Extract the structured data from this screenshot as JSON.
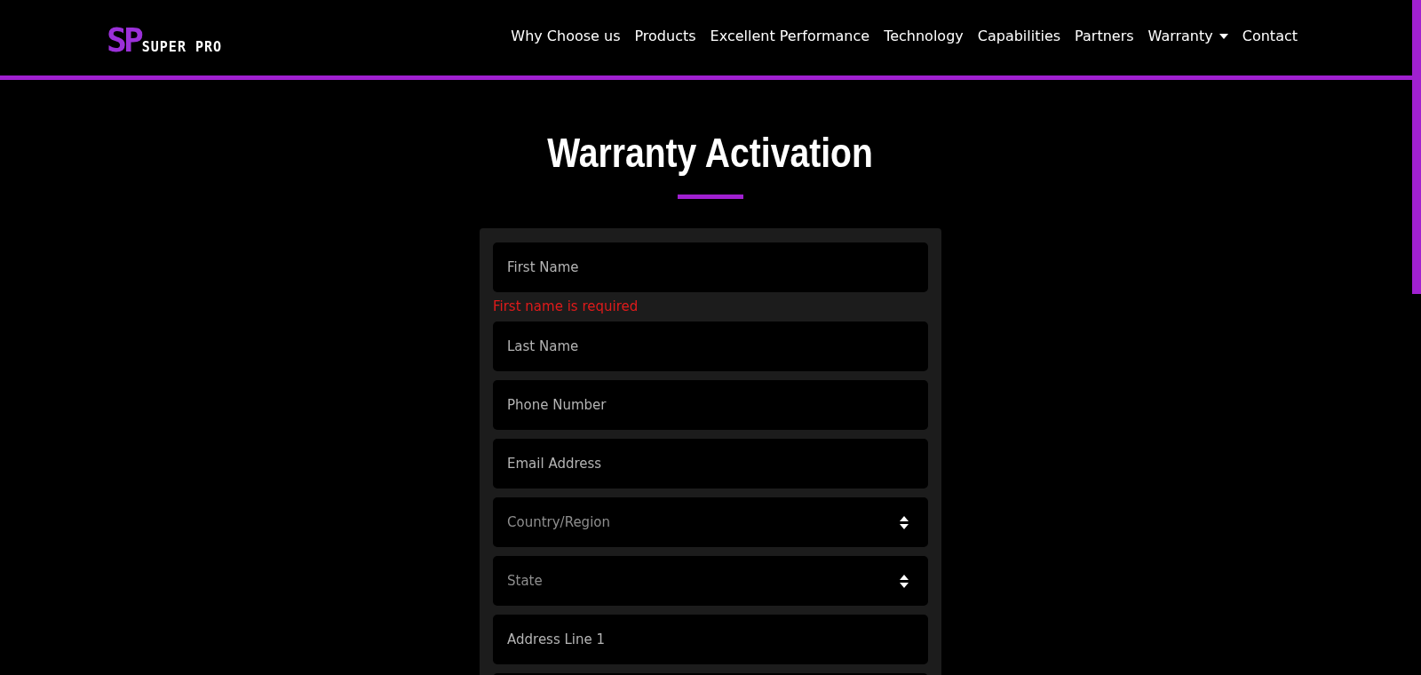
{
  "logo": {
    "mark": "SP",
    "text": "SUPER PRO"
  },
  "nav": [
    {
      "label": "Why Choose us",
      "dropdown": false
    },
    {
      "label": "Products",
      "dropdown": false
    },
    {
      "label": "Excellent Performance",
      "dropdown": false
    },
    {
      "label": "Technology",
      "dropdown": false
    },
    {
      "label": "Capabilities",
      "dropdown": false
    },
    {
      "label": "Partners",
      "dropdown": false
    },
    {
      "label": "Warranty",
      "dropdown": true
    },
    {
      "label": "Contact",
      "dropdown": false
    }
  ],
  "heading": "Warranty Activation",
  "form": {
    "fields": [
      {
        "kind": "input",
        "placeholder": "First Name",
        "error": "First name is required"
      },
      {
        "kind": "input",
        "placeholder": "Last Name"
      },
      {
        "kind": "input",
        "placeholder": "Phone Number"
      },
      {
        "kind": "input",
        "placeholder": "Email Address"
      },
      {
        "kind": "select",
        "placeholder": "Country/Region"
      },
      {
        "kind": "select",
        "placeholder": "State"
      },
      {
        "kind": "input",
        "placeholder": "Address Line 1"
      }
    ]
  }
}
